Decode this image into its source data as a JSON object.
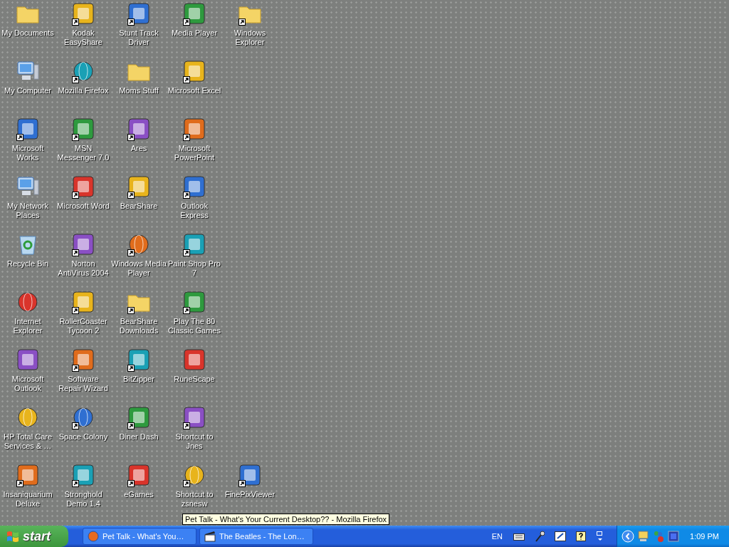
{
  "desktop": {
    "icons": [
      {
        "label": "My Documents",
        "kind": "folder",
        "shortcut": false
      },
      {
        "label": "Kodak EasyShare",
        "kind": "app",
        "shortcut": true
      },
      {
        "label": "Stunt Track Driver",
        "kind": "app",
        "shortcut": true
      },
      {
        "label": "Media Player",
        "kind": "app",
        "shortcut": true
      },
      {
        "label": "Windows Explorer",
        "kind": "folder",
        "shortcut": true
      },
      {
        "label": "My Computer",
        "kind": "computer",
        "shortcut": false
      },
      {
        "label": "Mozilla Firefox",
        "kind": "globe",
        "shortcut": true
      },
      {
        "label": "Moms Stuff",
        "kind": "folder",
        "shortcut": false
      },
      {
        "label": "Microsoft Excel",
        "kind": "app",
        "shortcut": true
      },
      {
        "label": "Microsoft Works",
        "kind": "app",
        "shortcut": true
      },
      {
        "label": "MSN Messenger 7.0",
        "kind": "app",
        "shortcut": true
      },
      {
        "label": "Ares",
        "kind": "app",
        "shortcut": true
      },
      {
        "label": "Microsoft PowerPoint",
        "kind": "app",
        "shortcut": true
      },
      {
        "label": "My Network Places",
        "kind": "computer",
        "shortcut": false
      },
      {
        "label": "Microsoft Word",
        "kind": "app",
        "shortcut": true
      },
      {
        "label": "BearShare",
        "kind": "app",
        "shortcut": true
      },
      {
        "label": "Outlook Express",
        "kind": "app",
        "shortcut": true
      },
      {
        "label": "Recycle Bin",
        "kind": "bin",
        "shortcut": false
      },
      {
        "label": "Norton AntiVirus 2004",
        "kind": "app",
        "shortcut": true
      },
      {
        "label": "Windows Media Player",
        "kind": "globe",
        "shortcut": true
      },
      {
        "label": "Paint Shop Pro 7",
        "kind": "app",
        "shortcut": true
      },
      {
        "label": "Internet Explorer",
        "kind": "globe",
        "shortcut": false
      },
      {
        "label": "RollerCoaster Tycoon 2",
        "kind": "app",
        "shortcut": true
      },
      {
        "label": "BearShare Downloads",
        "kind": "folder",
        "shortcut": true
      },
      {
        "label": "Play The 80 Classic Games",
        "kind": "app",
        "shortcut": true
      },
      {
        "label": "Microsoft Outlook",
        "kind": "app",
        "shortcut": false
      },
      {
        "label": "Software Repair Wizard",
        "kind": "app",
        "shortcut": true
      },
      {
        "label": "BitZipper",
        "kind": "app",
        "shortcut": true
      },
      {
        "label": "RuneScape",
        "kind": "app",
        "shortcut": false
      },
      {
        "label": "HP Total Care Services & …",
        "kind": "globe",
        "shortcut": false
      },
      {
        "label": "Space Colony",
        "kind": "globe",
        "shortcut": true
      },
      {
        "label": "Diner Dash",
        "kind": "app",
        "shortcut": true
      },
      {
        "label": "Shortcut to Jnes",
        "kind": "app",
        "shortcut": true
      },
      {
        "label": "Insaniquarium Deluxe",
        "kind": "app",
        "shortcut": true
      },
      {
        "label": "Stronghold Demo 1.4",
        "kind": "app",
        "shortcut": true
      },
      {
        "label": "eGames",
        "kind": "app",
        "shortcut": true
      },
      {
        "label": "Shortcut to zsnesw",
        "kind": "globe",
        "shortcut": true
      },
      {
        "label": "FinePixViewer",
        "kind": "app",
        "shortcut": true
      }
    ]
  },
  "tooltip": "Pet Talk - What's Your Current Desktop?? - Mozilla Firefox",
  "taskbar": {
    "start": "start",
    "tasks": [
      {
        "label": "Pet Talk - What's You…",
        "kind": "globe"
      },
      {
        "label": "The Beatles - The Lon…",
        "kind": "app"
      }
    ],
    "language": "EN",
    "clock": "1:09 PM"
  }
}
